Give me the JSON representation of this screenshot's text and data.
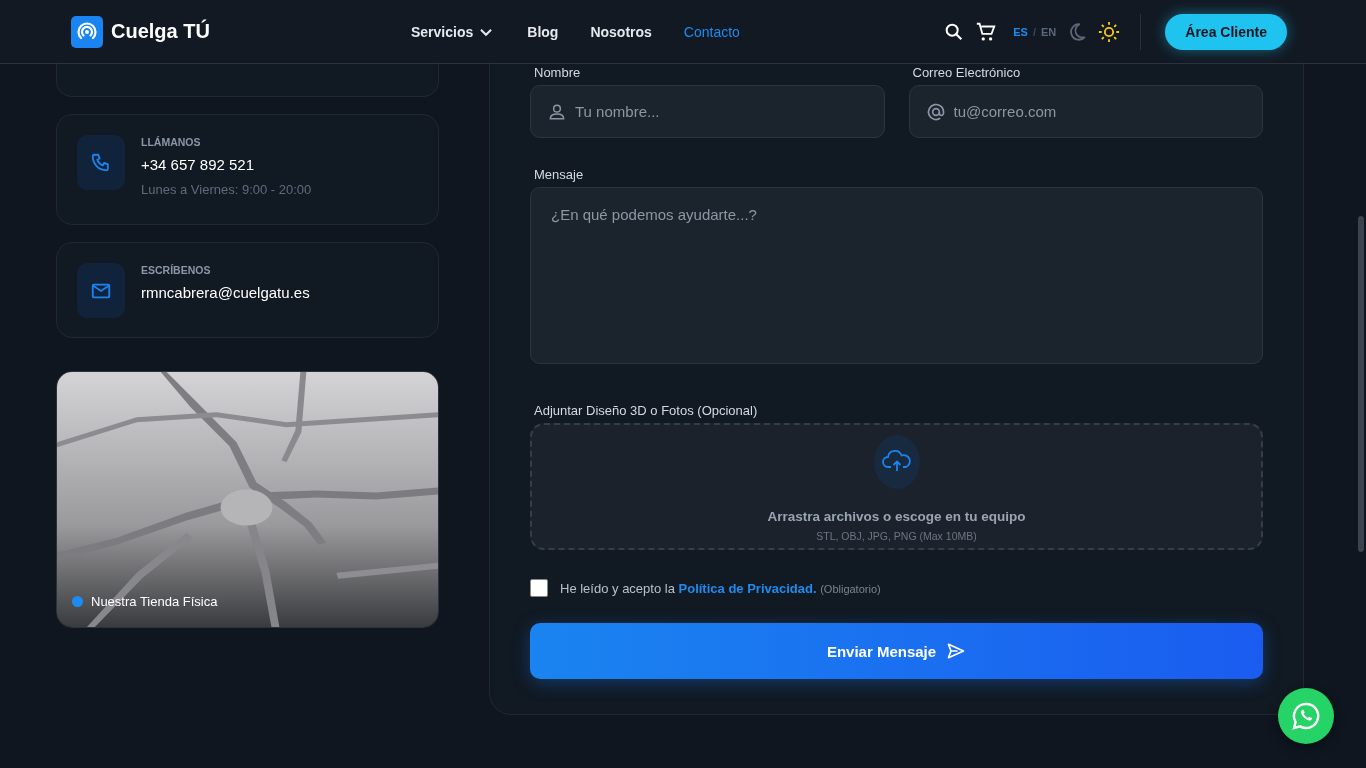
{
  "header": {
    "brand": "Cuelga TÚ",
    "nav": [
      {
        "label": "Servicios",
        "selected": false,
        "dropdown": true
      },
      {
        "label": "Blog",
        "selected": false,
        "dropdown": false
      },
      {
        "label": "Nosotros",
        "selected": false,
        "dropdown": false
      },
      {
        "label": "Contacto",
        "selected": true,
        "dropdown": false
      }
    ],
    "languages": [
      {
        "label": "ES",
        "selected": true
      },
      {
        "label": "EN",
        "selected": false
      }
    ],
    "language_separator": "/",
    "themes": [
      {
        "kind": "moon",
        "selected": false
      },
      {
        "kind": "sun",
        "selected": true
      }
    ],
    "cta": "Área Cliente"
  },
  "contact_cards": [
    {
      "kind": "address"
    },
    {
      "kind": "phone",
      "title": "LLÁMANOS",
      "value": "+34 657 892 521",
      "note": "Lunes a Viernes: 9:00 - 20:00"
    },
    {
      "kind": "email",
      "title": "ESCRÍBENOS",
      "value": "rmncabrera@cuelgatu.es"
    }
  ],
  "map": {
    "kind": "picture",
    "label": "Nuestra Tienda Física"
  },
  "form": {
    "fields": [
      {
        "kind": "person",
        "label": "Nombre",
        "placeholder": "Tu nombre..."
      },
      {
        "kind": "at",
        "label": "Correo Electrónico",
        "placeholder": "tu@correo.com"
      }
    ],
    "message": {
      "label": "Mensaje",
      "placeholder": "¿En qué podemos ayudarte...?"
    },
    "attachment": {
      "label": "Adjuntar Diseño 3D o Fotos (Opcional)",
      "prompt": "Arrastra archivos o escoge en tu equipo",
      "hint": "STL, OBJ, JPG, PNG (Max 10MB)"
    },
    "consent": {
      "checked": false,
      "text": "He leído y acepto la ",
      "link": "Política de Privacidad.",
      "note": "(Obligatorio)"
    },
    "submit": "Enviar Mensaje"
  }
}
